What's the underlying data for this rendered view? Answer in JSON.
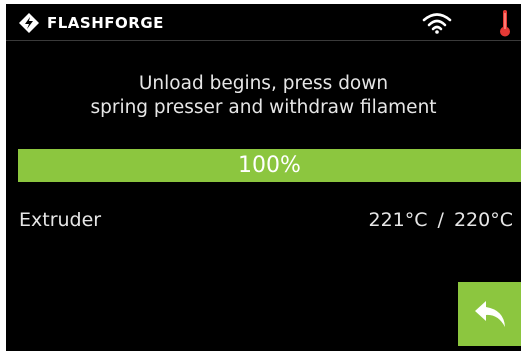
{
  "header": {
    "brand": "FLASHFORGE",
    "logo_icon": "flashforge-logo-icon",
    "wifi_icon": "wifi-icon",
    "thermometer_icon": "thermometer-icon"
  },
  "main": {
    "message_line1": "Unload begins, press down",
    "message_line2": "spring presser and withdraw filament",
    "progress": {
      "value": 100,
      "label": "100%"
    },
    "extruder": {
      "label": "Extruder",
      "current_temp": "221°C",
      "separator": "/",
      "target_temp": "220°C"
    }
  },
  "footer": {
    "back_icon": "back-arrow-icon"
  },
  "colors": {
    "accent": "#8cc63f",
    "background": "#000000",
    "text": "#e6e6e6",
    "thermometer": "#e53935"
  }
}
